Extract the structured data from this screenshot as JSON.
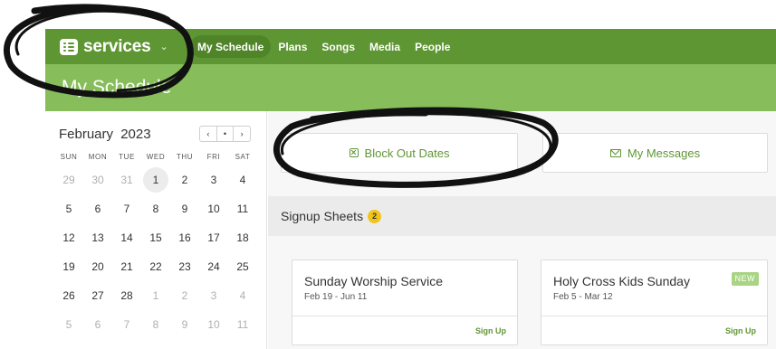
{
  "app": {
    "name": "services"
  },
  "nav": {
    "items": [
      {
        "label": "My Schedule",
        "active": true
      },
      {
        "label": "Plans"
      },
      {
        "label": "Songs"
      },
      {
        "label": "Media"
      },
      {
        "label": "People"
      }
    ]
  },
  "page": {
    "title": "My Schedule"
  },
  "calendar": {
    "month": "February",
    "year": "2023",
    "weekdays": [
      "SUN",
      "MON",
      "TUE",
      "WED",
      "THU",
      "FRI",
      "SAT"
    ],
    "nav": {
      "prev": "‹",
      "today": "•",
      "next": "›"
    },
    "days": [
      {
        "d": "29",
        "muted": true
      },
      {
        "d": "30",
        "muted": true
      },
      {
        "d": "31",
        "muted": true
      },
      {
        "d": "1",
        "today": true
      },
      {
        "d": "2"
      },
      {
        "d": "3"
      },
      {
        "d": "4"
      },
      {
        "d": "5"
      },
      {
        "d": "6"
      },
      {
        "d": "7"
      },
      {
        "d": "8"
      },
      {
        "d": "9"
      },
      {
        "d": "10"
      },
      {
        "d": "11"
      },
      {
        "d": "12"
      },
      {
        "d": "13"
      },
      {
        "d": "14"
      },
      {
        "d": "15"
      },
      {
        "d": "16"
      },
      {
        "d": "17"
      },
      {
        "d": "18"
      },
      {
        "d": "19"
      },
      {
        "d": "20"
      },
      {
        "d": "21"
      },
      {
        "d": "22"
      },
      {
        "d": "23"
      },
      {
        "d": "24"
      },
      {
        "d": "25"
      },
      {
        "d": "26"
      },
      {
        "d": "27"
      },
      {
        "d": "28"
      },
      {
        "d": "1",
        "muted": true
      },
      {
        "d": "2",
        "muted": true
      },
      {
        "d": "3",
        "muted": true
      },
      {
        "d": "4",
        "muted": true
      },
      {
        "d": "5",
        "muted": true
      },
      {
        "d": "6",
        "muted": true
      },
      {
        "d": "7",
        "muted": true
      },
      {
        "d": "8",
        "muted": true
      },
      {
        "d": "9",
        "muted": true
      },
      {
        "d": "10",
        "muted": true
      },
      {
        "d": "11",
        "muted": true
      }
    ]
  },
  "actions": {
    "block_out": "Block Out Dates",
    "messages": "My Messages"
  },
  "signups": {
    "label": "Signup Sheets",
    "count": "2",
    "cards": [
      {
        "title": "Sunday Worship Service",
        "dates": "Feb 19 - Jun 11",
        "action": "Sign Up",
        "badge": ""
      },
      {
        "title": "Holy Cross Kids Sunday",
        "dates": "Feb 5 - Mar 12",
        "action": "Sign Up",
        "badge": "NEW"
      }
    ]
  },
  "colors": {
    "nav_green": "#5f9634",
    "title_green": "#87bd5a",
    "badge_yellow": "#f2c418",
    "annotation": "#111111"
  }
}
